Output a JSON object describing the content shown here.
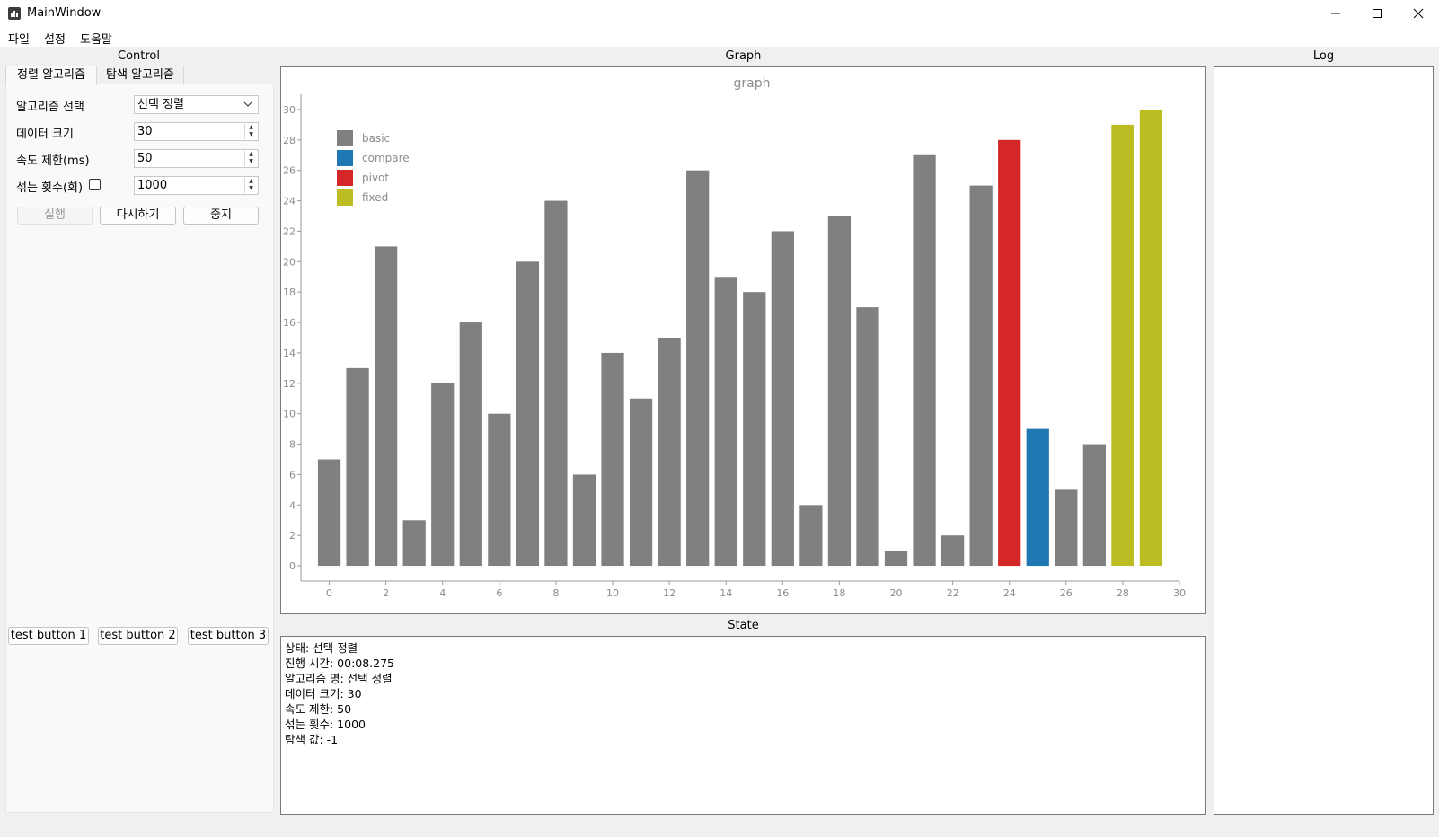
{
  "window": {
    "title": "MainWindow",
    "controls": [
      "minimize",
      "maximize",
      "close"
    ]
  },
  "menu": [
    "파일",
    "설정",
    "도움말"
  ],
  "sections": {
    "control": "Control",
    "graph": "Graph",
    "state": "State",
    "log": "Log"
  },
  "control": {
    "tabs": [
      "정렬 알고리즘",
      "탐색 알고리즘"
    ],
    "algorithm_label": "알고리즘 선택",
    "algorithm_value": "선택 정렬",
    "data_size_label": "데이터 크기",
    "data_size_value": "30",
    "speed_label": "속도 제한(ms)",
    "speed_value": "50",
    "shuffle_label": "섞는 횟수(회)",
    "shuffle_value": "1000",
    "run": "실행",
    "retry": "다시하기",
    "stop": "중지",
    "test_buttons": [
      "test button 1",
      "test button 2",
      "test button 3"
    ]
  },
  "chart_data": {
    "type": "bar",
    "title": "graph",
    "legend": [
      "basic",
      "compare",
      "pivot",
      "fixed"
    ],
    "colors": {
      "basic": "#808080",
      "compare": "#1f77b4",
      "pivot": "#d62728",
      "fixed": "#bcbd22"
    },
    "x": [
      0,
      1,
      2,
      3,
      4,
      5,
      6,
      7,
      8,
      9,
      10,
      11,
      12,
      13,
      14,
      15,
      16,
      17,
      18,
      19,
      20,
      21,
      22,
      23,
      24,
      25,
      26,
      27,
      28,
      29
    ],
    "values": [
      7,
      13,
      21,
      3,
      12,
      16,
      10,
      20,
      24,
      6,
      14,
      11,
      15,
      26,
      19,
      18,
      22,
      4,
      23,
      17,
      1,
      27,
      2,
      25,
      28,
      9,
      5,
      8,
      29,
      30
    ],
    "status": [
      "basic",
      "basic",
      "basic",
      "basic",
      "basic",
      "basic",
      "basic",
      "basic",
      "basic",
      "basic",
      "basic",
      "basic",
      "basic",
      "basic",
      "basic",
      "basic",
      "basic",
      "basic",
      "basic",
      "basic",
      "basic",
      "basic",
      "basic",
      "basic",
      "pivot",
      "compare",
      "basic",
      "basic",
      "fixed",
      "fixed"
    ],
    "xlim": [
      -1,
      30
    ],
    "ylim": [
      -1,
      31
    ],
    "xticks": [
      0,
      2,
      4,
      6,
      8,
      10,
      12,
      14,
      16,
      18,
      20,
      22,
      24,
      26,
      28,
      30
    ],
    "yticks": [
      0,
      2,
      4,
      6,
      8,
      10,
      12,
      14,
      16,
      18,
      20,
      22,
      24,
      26,
      28,
      30
    ],
    "legend_position": "top-left"
  },
  "state": {
    "lines": [
      "상태: 선택 정렬",
      "진행 시간: 00:08.275",
      "알고리즘 명: 선택 정렬",
      "데이터 크기: 30",
      "속도 제한: 50",
      "섞는 횟수: 1000",
      "탐색 값: -1"
    ]
  }
}
